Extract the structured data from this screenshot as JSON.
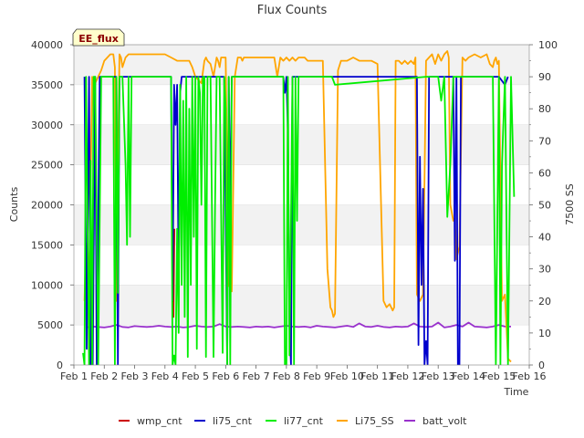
{
  "chart_data": {
    "type": "line",
    "title": "Flux Counts",
    "annotation": "EE_flux",
    "xlabel": "Time",
    "ylabel": "Counts",
    "y2label": "7500 SS",
    "ylim": [
      0,
      40000
    ],
    "y2lim": [
      0,
      100
    ],
    "xlim": [
      1,
      16
    ],
    "yticks": [
      0,
      5000,
      10000,
      15000,
      20000,
      25000,
      30000,
      35000,
      40000
    ],
    "y2ticks": [
      0,
      10,
      20,
      30,
      40,
      50,
      60,
      70,
      80,
      90,
      100
    ],
    "xticks": [
      1,
      2,
      3,
      4,
      5,
      6,
      7,
      8,
      9,
      10,
      11,
      12,
      13,
      14,
      15,
      16
    ],
    "xtick_labels": [
      "Feb 1",
      "Feb 2",
      "Feb 3",
      "Feb 4",
      "Feb 5",
      "Feb 6",
      "Feb 7",
      "Feb 8",
      "Feb 9",
      "Feb 10",
      "Feb 11",
      "Feb 12",
      "Feb 13",
      "Feb 14",
      "Feb 15",
      "Feb 16"
    ],
    "grid": true,
    "legend_position": "bottom",
    "series": [
      {
        "name": "wmp_cnt",
        "color": "#cc0000",
        "axis": "left",
        "x": [
          4.25,
          4.28,
          4.31
        ],
        "y": [
          17500,
          6000,
          17000
        ]
      },
      {
        "name": "li75_cnt",
        "color": "#0000cc",
        "axis": "left",
        "x": [
          1.35,
          1.42,
          1.5,
          1.55,
          1.62,
          1.7,
          1.75,
          1.85,
          1.9,
          2.0,
          2.4,
          2.45,
          2.5,
          4.0,
          4.2,
          4.25,
          4.3,
          4.35,
          4.4,
          4.45,
          4.5,
          4.55,
          4.6,
          4.7,
          5.0,
          5.1,
          5.3,
          5.95,
          6.05,
          6.1,
          6.15,
          6.2,
          7.9,
          7.95,
          8.0,
          8.05,
          8.1,
          8.15,
          8.2,
          12.2,
          12.3,
          12.35,
          12.4,
          12.45,
          12.5,
          12.55,
          12.6,
          12.65,
          12.7,
          13.5,
          13.55,
          13.6,
          13.65,
          13.7,
          13.75,
          15.0,
          15.2,
          15.3
        ],
        "y": [
          36000,
          2000,
          36000,
          0,
          0,
          36000,
          0,
          36000,
          36000,
          36000,
          36000,
          0,
          36000,
          36000,
          36000,
          8000,
          35000,
          30000,
          35000,
          10000,
          34000,
          36000,
          36000,
          36000,
          36000,
          36000,
          36000,
          36000,
          0,
          36000,
          18000,
          36000,
          36000,
          34000,
          36000,
          29000,
          5000,
          0,
          36000,
          36000,
          36000,
          2500,
          26000,
          10000,
          22000,
          0,
          3000,
          0,
          36000,
          36000,
          13000,
          36000,
          0,
          0,
          36000,
          36000,
          35000,
          36000
        ]
      },
      {
        "name": "li77_cnt",
        "color": "#00ee00",
        "axis": "left",
        "x": [
          1.3,
          1.35,
          1.4,
          1.5,
          1.55,
          1.6,
          1.65,
          1.7,
          1.8,
          1.9,
          1.95,
          2.0,
          2.2,
          2.3,
          2.35,
          2.4,
          2.45,
          2.5,
          2.6,
          2.7,
          2.75,
          2.8,
          2.85,
          2.9,
          3.0,
          4.2,
          4.25,
          4.3,
          4.35,
          4.4,
          4.45,
          4.5,
          4.55,
          4.6,
          4.65,
          4.7,
          4.75,
          4.8,
          4.85,
          4.9,
          4.95,
          5.0,
          5.05,
          5.1,
          5.15,
          5.2,
          5.25,
          5.3,
          5.35,
          5.4,
          5.5,
          5.6,
          5.65,
          5.7,
          5.8,
          5.9,
          5.95,
          6.0,
          6.05,
          6.1,
          6.15,
          6.2,
          6.3,
          7.85,
          7.9,
          7.95,
          8.0,
          8.05,
          8.1,
          8.15,
          8.2,
          8.25,
          8.3,
          8.35,
          8.4,
          8.5,
          9.5,
          9.6,
          12.6,
          12.7,
          13.0,
          13.1,
          13.2,
          13.3,
          13.4,
          13.5,
          13.6,
          14.8,
          14.9,
          15.0,
          15.05,
          15.1,
          15.2,
          15.3,
          15.4,
          15.5
        ],
        "y": [
          1500,
          0,
          36000,
          0,
          25500,
          0,
          36000,
          36000,
          0,
          36000,
          36000,
          36000,
          36000,
          36000,
          0,
          36000,
          9000,
          36000,
          36000,
          25000,
          15000,
          36000,
          16000,
          36000,
          36000,
          36000,
          0,
          1200,
          0,
          17000,
          4000,
          35000,
          10000,
          33000,
          6000,
          36000,
          1000,
          32000,
          10000,
          36000,
          16000,
          36000,
          2000,
          36000,
          34000,
          20000,
          36000,
          36000,
          1000,
          36000,
          36000,
          1000,
          20000,
          36000,
          36000,
          1500,
          36000,
          32000,
          0,
          36000,
          0,
          36000,
          36000,
          36000,
          36000,
          0,
          0,
          36000,
          1200,
          18000,
          36000,
          0,
          36000,
          18000,
          36000,
          36000,
          36000,
          35000,
          36000,
          36000,
          36000,
          33000,
          36000,
          18500,
          25000,
          36000,
          36000,
          36000,
          0,
          36000,
          0,
          25000,
          36000,
          0,
          36000,
          21000
        ]
      },
      {
        "name": "Li75_SS",
        "color": "#ffa500",
        "axis": "right",
        "x": [
          1.35,
          1.4,
          1.45,
          1.5,
          1.6,
          1.7,
          1.8,
          1.9,
          2.0,
          2.2,
          2.3,
          2.35,
          2.4,
          2.5,
          2.55,
          2.6,
          2.7,
          2.8,
          2.9,
          3.0,
          3.2,
          3.4,
          3.6,
          3.8,
          4.0,
          4.2,
          4.4,
          4.6,
          4.8,
          4.9,
          5.0,
          5.1,
          5.2,
          5.3,
          5.35,
          5.4,
          5.5,
          5.6,
          5.7,
          5.75,
          5.8,
          5.85,
          5.9,
          6.0,
          6.1,
          6.2,
          6.3,
          6.4,
          6.5,
          6.55,
          6.6,
          6.8,
          7.0,
          7.2,
          7.4,
          7.6,
          7.7,
          7.8,
          7.9,
          8.0,
          8.1,
          8.2,
          8.3,
          8.4,
          8.5,
          8.6,
          8.7,
          9.0,
          9.2,
          9.35,
          9.45,
          9.5,
          9.55,
          9.6,
          9.7,
          9.8,
          9.9,
          10.0,
          10.2,
          10.4,
          10.6,
          10.8,
          11.0,
          11.2,
          11.3,
          11.4,
          11.5,
          11.55,
          11.6,
          11.7,
          11.8,
          11.9,
          12.0,
          12.1,
          12.2,
          12.25,
          12.3,
          12.4,
          12.5,
          12.6,
          12.7,
          12.8,
          12.9,
          13.0,
          13.1,
          13.2,
          13.3,
          13.35,
          13.4,
          13.5,
          13.55,
          13.6,
          13.7,
          13.8,
          13.9,
          14.0,
          14.2,
          14.4,
          14.6,
          14.7,
          14.8,
          14.85,
          14.9,
          14.95,
          15.0,
          15.1,
          15.2,
          15.3,
          15.4
        ],
        "y": [
          20,
          38,
          37,
          22,
          90,
          88,
          90,
          92,
          95,
          97,
          97,
          93,
          20,
          97,
          96,
          93,
          96,
          97,
          97,
          97,
          97,
          97,
          97,
          97,
          97,
          96,
          95,
          95,
          95,
          93,
          90,
          89,
          88,
          95,
          96,
          95,
          94,
          90,
          96,
          95,
          93,
          96,
          96,
          96,
          25,
          23,
          90,
          96,
          96,
          95,
          96,
          96,
          96,
          96,
          96,
          96,
          90,
          96,
          95,
          96,
          95,
          96,
          95,
          96,
          96,
          96,
          95,
          95,
          95,
          30,
          18,
          17,
          15,
          16,
          92,
          95,
          95,
          95,
          96,
          95,
          95,
          95,
          94,
          20,
          18,
          19,
          17,
          18,
          95,
          95,
          94,
          95,
          94,
          95,
          94,
          96,
          22,
          20,
          22,
          95,
          96,
          97,
          94,
          97,
          95,
          97,
          98,
          96,
          50,
          45,
          46,
          33,
          37,
          96,
          95,
          96,
          97,
          96,
          97,
          94,
          93,
          95,
          96,
          94,
          95,
          20,
          22,
          2,
          1
        ]
      },
      {
        "name": "batt_volt",
        "color": "#9932cc",
        "axis": "left",
        "x": [
          1.4,
          1.6,
          1.8,
          2.0,
          2.2,
          2.4,
          2.6,
          2.8,
          3.0,
          3.2,
          3.4,
          3.6,
          3.8,
          4.0,
          4.2,
          4.4,
          4.6,
          4.8,
          5.0,
          5.2,
          5.4,
          5.6,
          5.8,
          6.0,
          6.2,
          6.4,
          6.6,
          6.8,
          7.0,
          7.2,
          7.4,
          7.6,
          7.8,
          8.0,
          8.2,
          8.4,
          8.6,
          8.8,
          9.0,
          9.2,
          9.4,
          9.6,
          9.8,
          10.0,
          10.2,
          10.4,
          10.6,
          10.8,
          11.0,
          11.2,
          11.4,
          11.6,
          11.8,
          12.0,
          12.2,
          12.4,
          12.6,
          12.8,
          13.0,
          13.2,
          13.4,
          13.6,
          13.8,
          14.0,
          14.2,
          14.4,
          14.6,
          14.8,
          15.0,
          15.2,
          15.4
        ],
        "y": [
          4700,
          4800,
          4750,
          4700,
          4800,
          5000,
          4750,
          4700,
          4850,
          4800,
          4750,
          4800,
          4900,
          4800,
          4750,
          4800,
          4700,
          4750,
          4900,
          4800,
          4750,
          4800,
          5100,
          4800,
          4750,
          4800,
          4750,
          4700,
          4800,
          4750,
          4800,
          4700,
          4800,
          4900,
          4800,
          4750,
          4800,
          4700,
          4900,
          4800,
          4750,
          4700,
          4800,
          4900,
          4750,
          5200,
          4800,
          4750,
          4900,
          4750,
          4700,
          4800,
          4750,
          4800,
          5200,
          4800,
          4750,
          4800,
          5300,
          4700,
          4800,
          5000,
          4800,
          5300,
          4800,
          4750,
          4700,
          4800,
          5000,
          4800,
          4800
        ]
      }
    ]
  }
}
